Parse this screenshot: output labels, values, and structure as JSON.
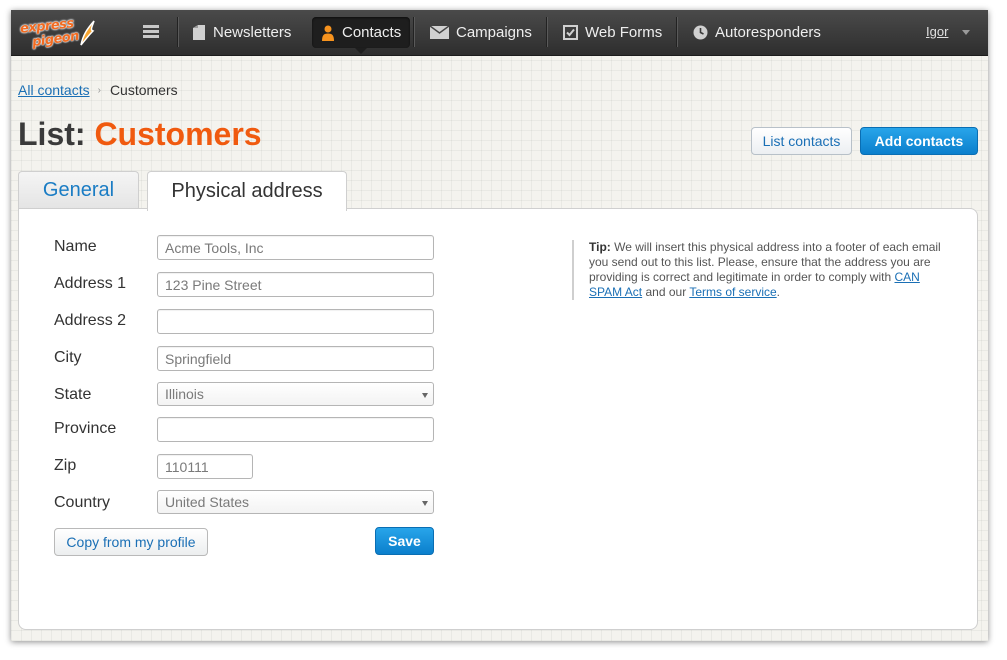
{
  "brand": {
    "line1": "express",
    "line2": "pigeon",
    "accent": "#f26b21"
  },
  "nav": {
    "items": [
      {
        "label": "Newsletters",
        "icon": "newsletter-icon"
      },
      {
        "label": "Contacts",
        "icon": "contacts-icon",
        "active": true
      },
      {
        "label": "Campaigns",
        "icon": "envelope-icon"
      },
      {
        "label": "Web Forms",
        "icon": "checkbox-icon"
      },
      {
        "label": "Autoresponders",
        "icon": "clock-icon"
      }
    ],
    "user": "Igor"
  },
  "breadcrumb": {
    "link": "All contacts",
    "current": "Customers"
  },
  "header": {
    "title_prefix": "List:",
    "title_name": "Customers",
    "list_contacts_label": "List contacts",
    "add_contacts_label": "Add contacts"
  },
  "tabs": [
    {
      "label": "General",
      "active": false
    },
    {
      "label": "Physical address",
      "active": true
    }
  ],
  "form": {
    "name": {
      "label": "Name",
      "placeholder": "Acme Tools, Inc"
    },
    "address1": {
      "label": "Address 1",
      "placeholder": "123 Pine Street"
    },
    "address2": {
      "label": "Address 2",
      "placeholder": ""
    },
    "city": {
      "label": "City",
      "placeholder": "Springfield"
    },
    "state": {
      "label": "State",
      "value": "Illinois"
    },
    "province": {
      "label": "Province",
      "placeholder": ""
    },
    "zip": {
      "label": "Zip",
      "placeholder": "110111"
    },
    "country": {
      "label": "Country",
      "value": "United States"
    },
    "copy_label": "Copy from my profile",
    "save_label": "Save"
  },
  "tip": {
    "prefix": "Tip:",
    "text": "We will insert this physical address into a footer of each email you send out to this list. Please, ensure that the address you are providing is correct and legitimate in order to comply with",
    "link1": "CAN SPAM Act",
    "and_text": "and our",
    "link2": "Terms of service",
    "end": "."
  },
  "colors": {
    "primary_button": "#0b7fcc",
    "title_accent": "#f05a0f",
    "link": "#1a6fb5"
  }
}
